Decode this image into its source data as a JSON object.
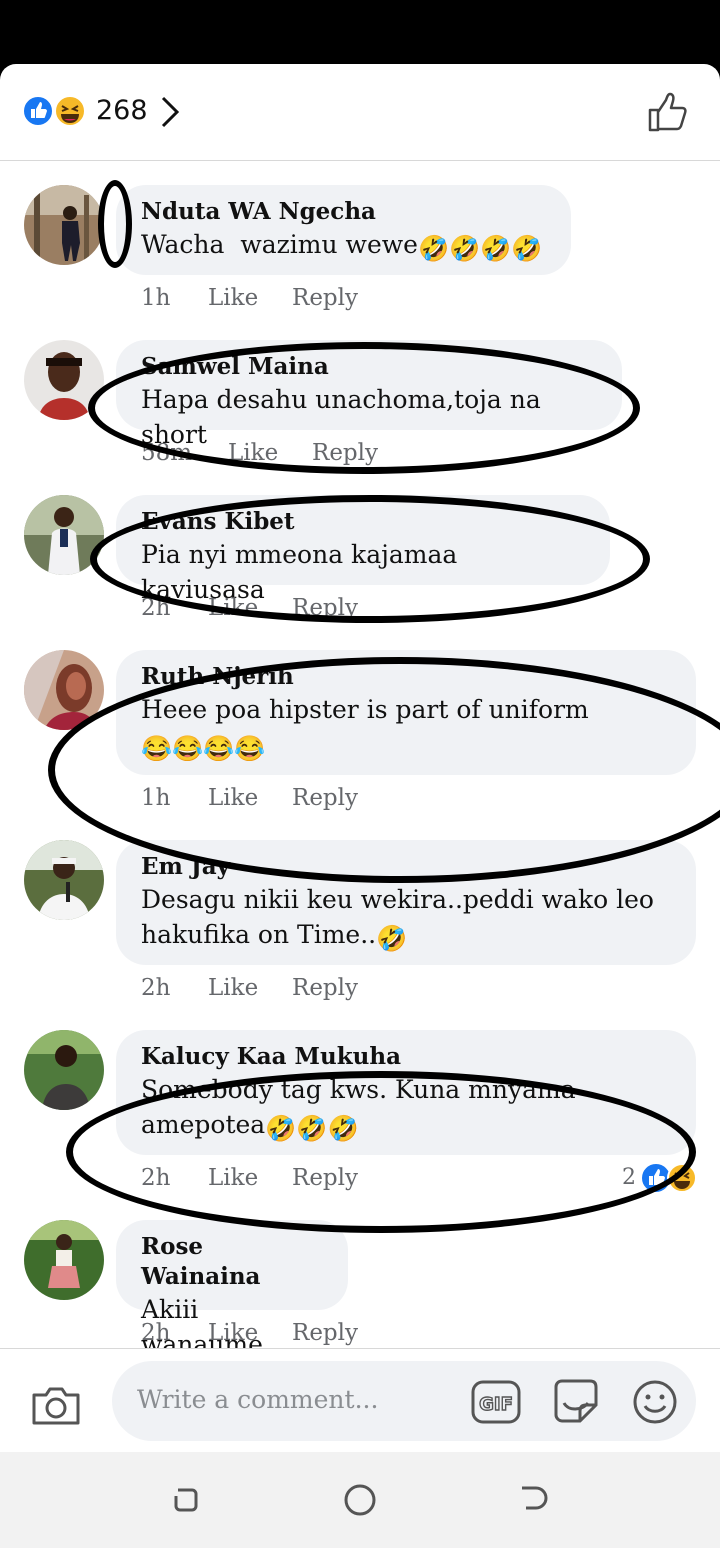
{
  "header": {
    "reaction_count": "268"
  },
  "comments": [
    {
      "name": "Nduta WA Ngecha",
      "text": "Wacha  wazimu wewe",
      "emoji": "🤣🤣🤣🤣",
      "time": "1h",
      "like": "Like",
      "reply": "Reply"
    },
    {
      "name": "Samwel Maina",
      "text": "Hapa desahu unachoma,toja na short",
      "emoji": "",
      "time": "58m",
      "like": "Like",
      "reply": "Reply"
    },
    {
      "name": "Evans Kibet",
      "text": "Pia nyi mmeona kajamaa kaviusasa",
      "emoji": "",
      "time": "2h",
      "like": "Like",
      "reply": "Reply"
    },
    {
      "name": "Ruth Njerih",
      "text": "Heee poa hipster is part of uniform ",
      "emoji": "😂😂😂😂",
      "time": "1h",
      "like": "Like",
      "reply": "Reply"
    },
    {
      "name": "Em  Jay",
      "text": "Desagu nikii keu wekira..peddi wako leo hakufika on Time..",
      "emoji": "🤣",
      "time": "2h",
      "like": "Like",
      "reply": "Reply"
    },
    {
      "name": "Kalucy Kaa Mukuha",
      "text": "Somebody tag kws. Kuna mnyama amepotea",
      "emoji": "🤣🤣🤣",
      "time": "2h",
      "like": "Like",
      "reply": "Reply",
      "reaction_count": "2"
    },
    {
      "name": "Rose Wainaina",
      "text": "Akiii wanaume",
      "emoji": "",
      "time": "2h",
      "like": "Like",
      "reply": "Reply"
    }
  ],
  "composer": {
    "placeholder": "Write a comment..."
  },
  "icons": {
    "like_reaction": "like-icon",
    "haha_reaction": "haha-icon",
    "camera": "camera-icon",
    "gif": "gif-icon",
    "sticker": "sticker-icon",
    "emoji": "smiley-icon"
  },
  "colors": {
    "like_blue": "#1877f2",
    "haha_yellow": "#f7b928",
    "bubble": "#f0f2f5",
    "meta_gray": "#65676b"
  }
}
